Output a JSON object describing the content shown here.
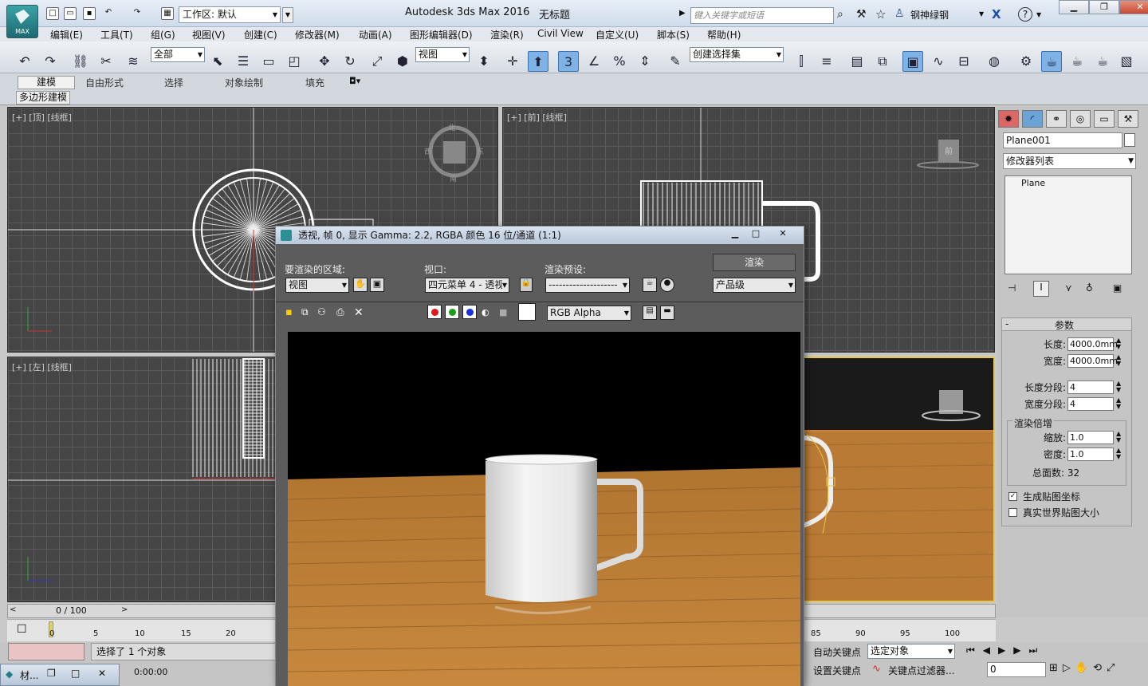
{
  "titlebar": {
    "workspace": "工作区: 默认",
    "app_title": "Autodesk 3ds Max 2016",
    "doc_title": "无标题",
    "search_placeholder": "键入关键字或短语",
    "user": "钢神绿钢",
    "logo": "MAX"
  },
  "menu": [
    "编辑(E)",
    "工具(T)",
    "组(G)",
    "视图(V)",
    "创建(C)",
    "修改器(M)",
    "动画(A)",
    "图形编辑器(D)",
    "渲染(R)",
    "Civil View",
    "自定义(U)",
    "脚本(S)",
    "帮助(H)"
  ],
  "toolbar": {
    "filter": "全部",
    "ref_coord": "视图",
    "snap_label": "3",
    "selection_set": "创建选择集"
  },
  "ribbon": {
    "tabs": [
      "建模",
      "自由形式",
      "选择",
      "对象绘制",
      "填充"
    ],
    "panel": "多边形建模"
  },
  "viewports": {
    "top": "[+] [顶] [线框]",
    "front": "[+] [前] [线框]",
    "left": "[+] [左] [线框]",
    "viewcube_top": [
      "北",
      "西",
      "东",
      "南"
    ],
    "viewcube_front": "前"
  },
  "render_window": {
    "title": "透视, 帧 0, 显示 Gamma: 2.2, RGBA 颜色 16 位/通道 (1:1)",
    "area_label": "要渲染的区域:",
    "area_value": "视图",
    "viewport_label": "视口:",
    "viewport_value": "四元菜单 4 - 透视",
    "preset_label": "渲染预设:",
    "preset_value": "--------------------",
    "render_button": "渲染",
    "quality_value": "产品级",
    "channel_value": "RGB Alpha"
  },
  "command_panel": {
    "object_name": "Plane001",
    "modifier_list": "修改器列表",
    "stack_item": "Plane",
    "params_title": "参数",
    "params": [
      {
        "label": "长度:",
        "value": "4000.0mm"
      },
      {
        "label": "宽度:",
        "value": "4000.0mm"
      },
      {
        "label": "长度分段:",
        "value": "4"
      },
      {
        "label": "宽度分段:",
        "value": "4"
      }
    ],
    "render_mult_title": "渲染倍增",
    "render_mult": [
      {
        "label": "缩放:",
        "value": "1.0"
      },
      {
        "label": "密度:",
        "value": "1.0"
      }
    ],
    "total_faces": "总面数: 32",
    "gen_mapping": "生成贴图坐标",
    "real_world": "真实世界贴图大小"
  },
  "timeline": {
    "frame": "0 / 100",
    "ticks_left": [
      "0",
      "5",
      "10",
      "15",
      "20"
    ],
    "ticks_right": [
      "85",
      "90",
      "95",
      "100"
    ]
  },
  "status": {
    "selected": "选择了 1 个对象",
    "time": "0:00:00",
    "autokey": "自动关键点",
    "setkey": "设置关键点",
    "sel_obj": "选定对象",
    "key_filter": "关键点过滤器...",
    "frame_field": "0",
    "taskbar_item": "材..."
  }
}
